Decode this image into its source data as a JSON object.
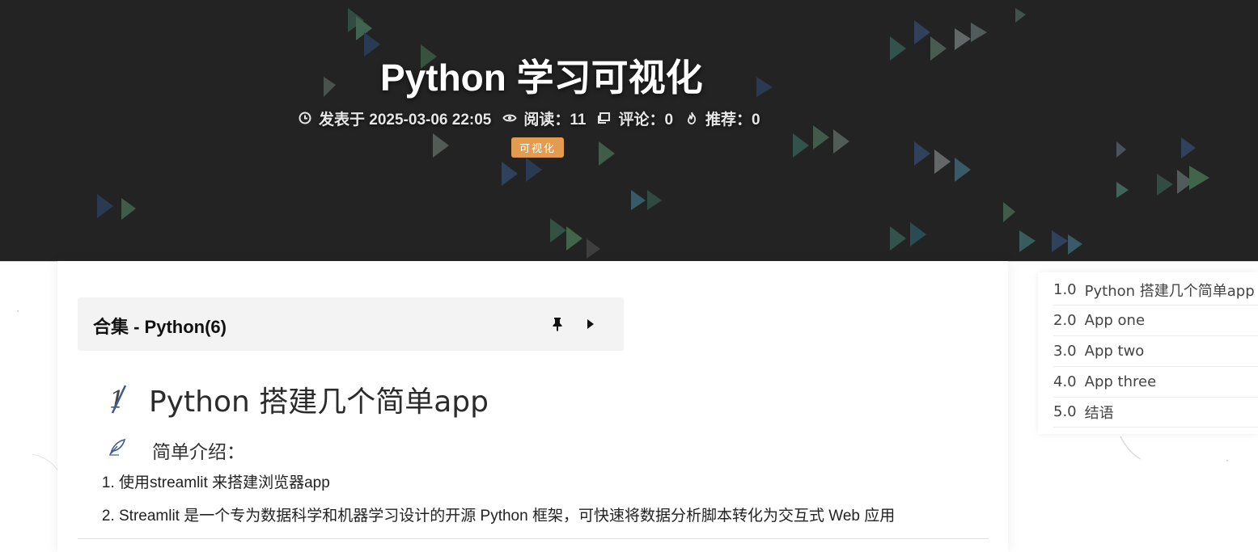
{
  "header": {
    "title": "Python 学习可视化",
    "meta": {
      "posted_label": "发表于 2025-03-06 22:05",
      "views_label": "阅读：11",
      "comments_label": "评论：0",
      "recommend_label": "推荐：0"
    },
    "tag": "可视化",
    "colors": {
      "background": "#232323",
      "tag": "#e39b4f"
    }
  },
  "article": {
    "collection_label": "合集 - Python(6)",
    "heading": "Python 搭建几个简单app",
    "subheading": "简单介绍：",
    "intro_items": [
      "使用streamlit 来搭建浏览器app",
      "Streamlit 是一个专为数据科学和机器学习设计的开源 Python 框架，可快速将数据分析脚本转化为交互式 Web 应用"
    ]
  },
  "toc": {
    "items": [
      {
        "num": "1.0",
        "label": "Python 搭建几个简单app"
      },
      {
        "num": "2.0",
        "label": "App one"
      },
      {
        "num": "3.0",
        "label": "App two"
      },
      {
        "num": "4.0",
        "label": "App three"
      },
      {
        "num": "5.0",
        "label": "结语"
      }
    ]
  },
  "icons": {
    "posted": "clock-icon",
    "views": "eye-icon",
    "comments": "comment-icon",
    "recommend": "flame-icon",
    "pin": "pin-icon",
    "expand": "play-icon",
    "heading": "number-one-icon",
    "subheading": "feather-pen-icon"
  }
}
